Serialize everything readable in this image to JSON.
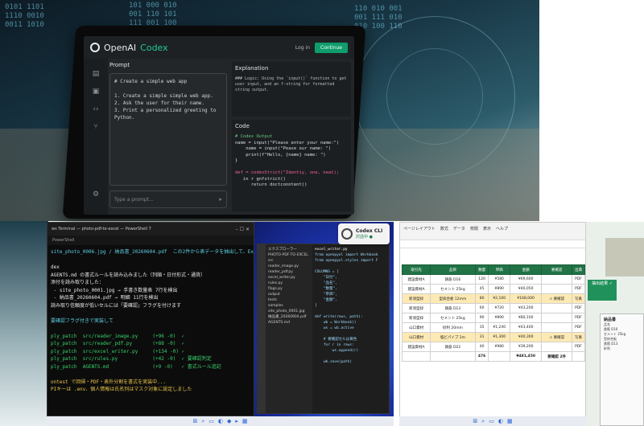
{
  "codex_app": {
    "brand_prefix": "OpenAI",
    "brand_name": "Codex",
    "login_label": "Log in",
    "continue_label": "Continue",
    "prompt_title": "Prompt",
    "prompt_lines": [
      "# Create a simple web app",
      "",
      "1. Create a simple simple web app.",
      "2. Ask the user for their name.",
      "3. Print a personalized greeting to Python."
    ],
    "prompt_placeholder": "Type a prompt...",
    "explanation_title": "Explanation",
    "explanation_text": "### Logic: Using the `input()` function to get user input, and an f-string for formatted string output.",
    "code_title": "Code",
    "code_lines": [
      "# Codex Output",
      "name = input(\"Please enter your name:\")",
      "    name = input(\"Pease our name: \")",
      "    print(f\"Hello, {name} name: \")",
      "}",
      "",
      "def = codexStrict(\"Identiy, one, neat);",
      "   in r gnfstrict()",
      "      return doctconntent()"
    ]
  },
  "terminal": {
    "title": "ws Terminal — photo-pdf-to-excel — PowerShell 7",
    "tab_label": "PowerShell",
    "lines": [
      {
        "t": "site_photo_0006.jpg / 納品書_20260604.pdf  この2件から表データを抽出して、Excelにして",
        "c": "c"
      },
      {
        "t": "",
        "c": ""
      },
      {
        "t": "dex",
        "c": ""
      },
      {
        "t": "AGENTS.md の書式ルールを読み込みました（列順・日付形式・通貨）",
        "c": ""
      },
      {
        "t": "添付を読み取りました：",
        "c": ""
      },
      {
        "t": " - site_photo_0001.jpg → 手書き数量表 7行を検出",
        "c": ""
      },
      {
        "t": " - 納品書_20260604.pdf → 明細 11行を検出",
        "c": ""
      },
      {
        "t": "読み取り信頼度が低いセルには「要確認」フラグを付けます",
        "c": ""
      },
      {
        "t": "",
        "c": ""
      },
      {
        "t": "要確認フラグ付きで実装して",
        "c": "c"
      },
      {
        "t": "",
        "c": ""
      },
      {
        "t": "ply_patch  src/reader_image.py     (+96 -0)  ✓",
        "c": "g"
      },
      {
        "t": "ply_patch  src/reader_pdf.py       (+88 -0)  ✓",
        "c": "g"
      },
      {
        "t": "ply_patch  src/excel_writer.py     (+134 -0) ✓",
        "c": "g"
      },
      {
        "t": "ply_patch  src/rules.py            (+42 -0)  ✓ 要確認判定",
        "c": "g"
      },
      {
        "t": "ply_patch  AGENTS.md               (+9 -0)   ✓ 書式ルール追記",
        "c": "g"
      },
      {
        "t": "",
        "c": ""
      },
      {
        "t": "ontest で回帰・PDF・表外分割を書式を実装中...",
        "c": "y"
      },
      {
        "t": "PIキーは .env、個人情報は氏名列はマスク対象に設定しました",
        "c": "y"
      }
    ]
  },
  "codex_cli_badge": {
    "title": "Codex CLI",
    "status": "対話中 ●"
  },
  "vscode": {
    "explorer_title": "エクスプローラー",
    "folder": "PHOTO-PDF-TO-EXCEL",
    "files": [
      "src",
      "reader_image.py",
      "reader_pdf.py",
      "excel_writer.py",
      "rules.py",
      "flags.py",
      "output",
      "tests",
      "samples",
      "site_photo_0001.jpg",
      "納品書_20260604.pdf",
      "AGENTS.md"
    ],
    "tab": "excel_writer.py",
    "code": [
      "from openpyxl import Workbook",
      "from openpyxl.styles import F",
      "",
      "COLUMNS = [",
      "    \"日付\",",
      "    \"品名\",",
      "    \"数量\",",
      "    \"単価\",",
      "    \"金額\",",
      "]",
      "",
      "def write(rows, path):",
      "    wb = Workbook()",
      "    ws = wb.active",
      "",
      "    # 要確認セルは黄色",
      "    for r in rows:",
      "        ws.append(r)",
      "",
      "    wb.save(path)"
    ]
  },
  "excel": {
    "ribbon": [
      "ページレイアウト",
      "数式",
      "データ",
      "校閲",
      "表示",
      "ヘルプ"
    ],
    "headers": [
      "取引先",
      "品目",
      "数量",
      "単価",
      "金額",
      "要確認",
      "出典"
    ],
    "rows": [
      {
        "cells": [
          "建設資材A",
          "鉄筋 D16",
          "120",
          "¥580",
          "¥69,600",
          "",
          "PDF"
        ],
        "hl": false
      },
      {
        "cells": [
          "建設資材A",
          "セメント 25kg",
          "45",
          "¥890",
          "¥40,050",
          "",
          "PDF"
        ],
        "hl": false
      },
      {
        "cells": [
          "新潟型枠",
          "型枠合板 12mm",
          "80",
          "¥2,100",
          "¥168,000",
          "⚠ 要確認",
          "写真"
        ],
        "hl": true
      },
      {
        "cells": [
          "新潟型枠",
          "鉄筋 D13",
          "60",
          "¥720",
          "¥43,200",
          "",
          "PDF"
        ],
        "hl": false
      },
      {
        "cells": [
          "新潟型枠",
          "セメント 25kg",
          "90",
          "¥890",
          "¥80,100",
          "",
          "PDF"
        ],
        "hl": false
      },
      {
        "cells": [
          "山口資材",
          "砂利 20mm",
          "35",
          "¥1,240",
          "¥43,400",
          "",
          "PDF"
        ],
        "hl": false
      },
      {
        "cells": [
          "山口資材",
          "塩ビパイプ 2m",
          "31",
          "¥1,300",
          "¥40,300",
          "⚠ 要確認",
          "写真"
        ],
        "hl": true
      },
      {
        "cells": [
          "建設資材A",
          "鉄筋 D22",
          "40",
          "¥980",
          "¥39,200",
          "",
          "PDF"
        ],
        "hl": false
      },
      {
        "cells": [
          "",
          "",
          "476",
          "",
          "¥481,450",
          "要確認 2件",
          ""
        ],
        "hl": false,
        "tot": true
      }
    ]
  },
  "right_panel": {
    "tag": "抽出結果 ✓",
    "doc_title": "納品書",
    "doc_lines": [
      "品名",
      "鉄筋 D16",
      "セメント 25kg",
      "型枠合板",
      "鉄筋 D13",
      "砂利"
    ]
  },
  "taskbar_icons": [
    "windows-icon",
    "search-icon",
    "folder-icon",
    "edge-icon",
    "vscode-icon",
    "terminal-icon",
    "excel-icon"
  ]
}
